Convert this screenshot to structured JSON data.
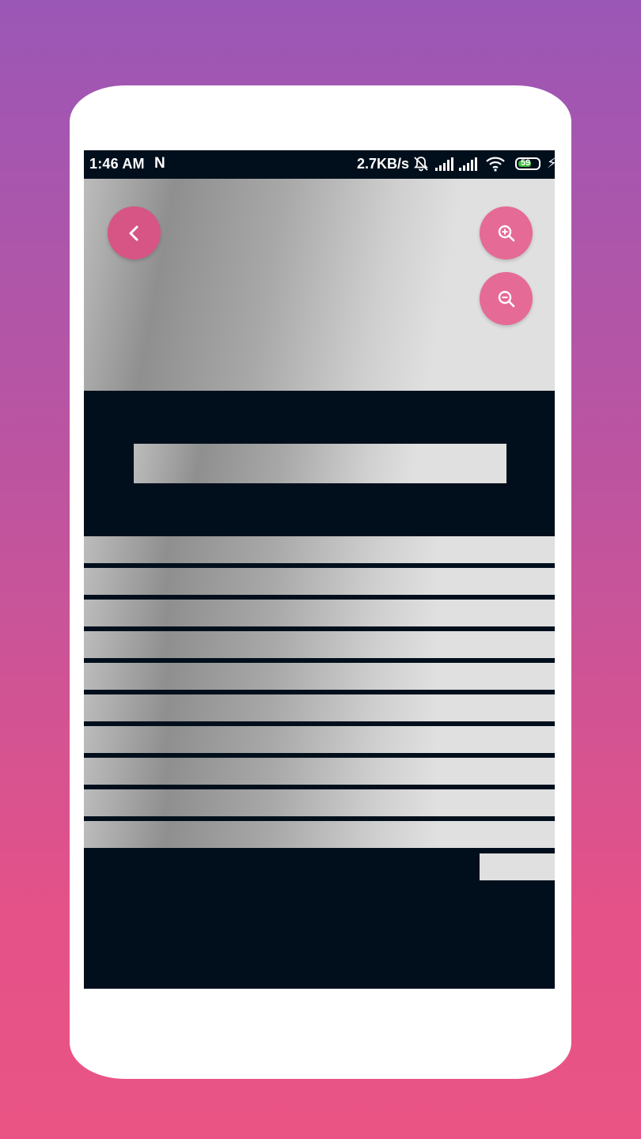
{
  "status_bar": {
    "time": "1:46 AM",
    "network_icon": "N",
    "speed": "2.7KB/s",
    "battery_level": "59",
    "icons": [
      "notifications-off-icon",
      "signal-icon",
      "signal-icon",
      "wifi-icon",
      "battery-icon",
      "charging-bolt-icon"
    ]
  },
  "colors": {
    "background_top": "#9b57b6",
    "background_bottom": "#ea5485",
    "screen_bg": "#010f1c",
    "fab_primary": "#d65585",
    "fab_secondary": "#e56a96",
    "placeholder_light": "#e0e0e0",
    "placeholder_dark": "#8f8f8f"
  },
  "buttons": {
    "back_icon": "chevron-left-icon",
    "zoom_in_icon": "zoom-in-icon",
    "zoom_out_icon": "zoom-out-icon"
  },
  "content": {
    "state": "loading-placeholders",
    "placeholder_rows": 10
  }
}
